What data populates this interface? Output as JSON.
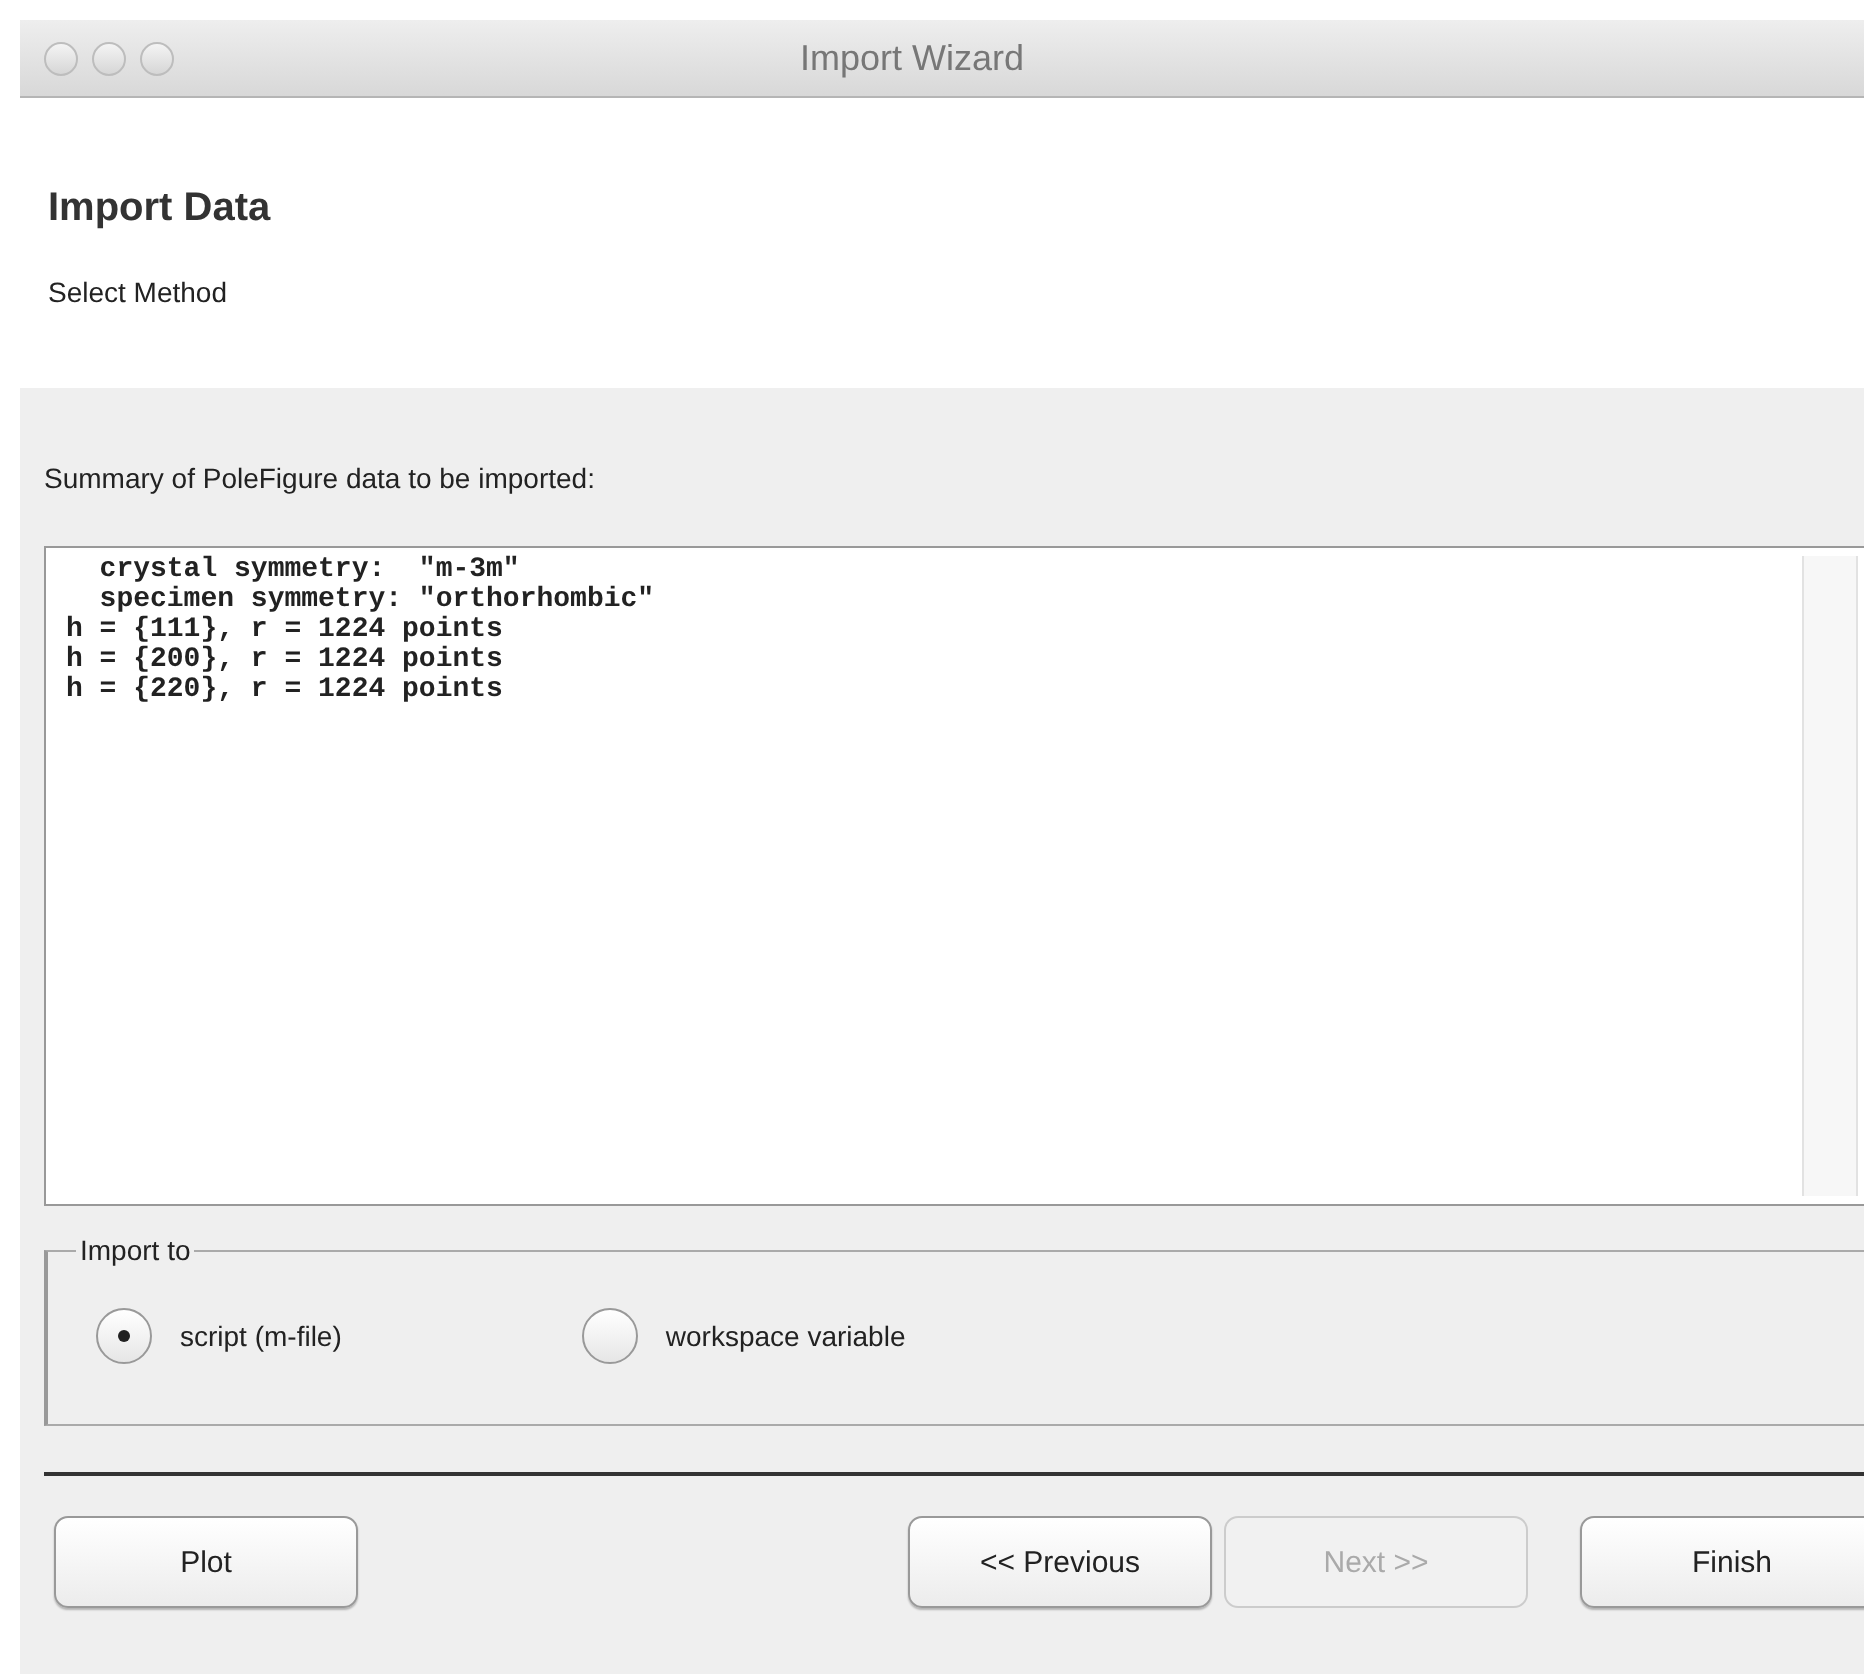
{
  "window": {
    "title": "Import Wizard"
  },
  "header": {
    "title": "Import Data",
    "subtitle": "Select Method"
  },
  "summary": {
    "label": "Summary of PoleFigure data to be imported:",
    "lines": [
      "  crystal symmetry:  \"m-3m\"",
      "  specimen symmetry: \"orthorhombic\"",
      "h = {111}, r = 1224 points",
      "h = {200}, r = 1224 points",
      "h = {220}, r = 1224 points"
    ]
  },
  "import_to": {
    "label": "Import to",
    "options": [
      {
        "label": "script (m-file)",
        "selected": true
      },
      {
        "label": "workspace variable",
        "selected": false
      }
    ]
  },
  "left_buttons": [
    {
      "label": "Plot",
      "disabled": false
    }
  ],
  "right_buttons": [
    {
      "label": "<< Previous",
      "disabled": false
    },
    {
      "label": "Next >>",
      "disabled": true
    },
    {
      "label": "Finish",
      "disabled": false
    }
  ]
}
